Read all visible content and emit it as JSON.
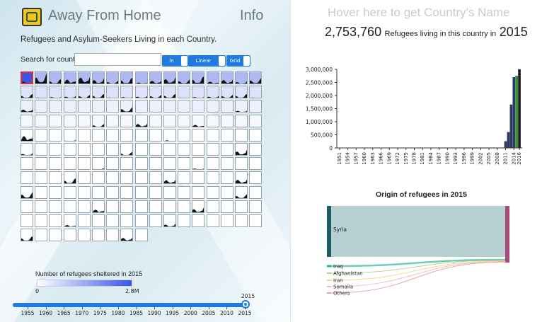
{
  "header": {
    "app_title": "Away From Home",
    "info_label": "Info",
    "subtitle": "Refugees and Asylum-Seekers Living in each Country."
  },
  "search": {
    "label": "Search for country:",
    "value": ""
  },
  "toggles": [
    {
      "label": "ln"
    },
    {
      "label": "Linear"
    },
    {
      "label": "Grid"
    }
  ],
  "legend": {
    "title": "Number of refugees sheltered in 2015",
    "min_label": "0",
    "max_label": "2.8M",
    "colors": [
      "#ffffff",
      "#3b55e6"
    ]
  },
  "slider": {
    "value": "2015",
    "ticks": [
      "1955",
      "1960",
      "1965",
      "1970",
      "1975",
      "1980",
      "1985",
      "1990",
      "1995",
      "2000",
      "2005",
      "2010",
      "2015"
    ]
  },
  "info_panel": {
    "hover_prompt": "Hover here to get Country's Name",
    "count": "2,753,760",
    "count_text": "Refugees living in this country in",
    "year": "2015"
  },
  "chart_data": [
    {
      "type": "bar",
      "ylim": [
        0,
        3000000
      ],
      "yticks": [
        "0",
        "500,000",
        "1,000,000",
        "1,500,000",
        "2,000,000",
        "2,500,000",
        "3,000,000"
      ],
      "xticks": [
        "1951",
        "1954",
        "1957",
        "1960",
        "1963",
        "1966",
        "1969",
        "1972",
        "1975",
        "1978",
        "1981",
        "1984",
        "1987",
        "1990",
        "1993",
        "1996",
        "1999",
        "2002",
        "2005",
        "2008",
        "2011",
        "2014",
        "2016"
      ],
      "series": [
        {
          "x": [
            1987,
            1988,
            1989,
            1990,
            1991,
            1992,
            1993,
            1994,
            1995,
            1996,
            1997,
            1998,
            1999,
            2000,
            2001,
            2002,
            2003,
            2004,
            2005,
            2006,
            2007,
            2008,
            2009,
            2010,
            2011,
            2012,
            2013,
            2014,
            2015,
            2016
          ],
          "values": [
            5000,
            5000,
            5000,
            8000,
            8000,
            8000,
            8000,
            8000,
            8000,
            5000,
            5000,
            5000,
            5000,
            5000,
            5000,
            5000,
            5000,
            5000,
            5000,
            5000,
            5000,
            5000,
            8000,
            10000,
            250000,
            600000,
            1650000,
            2700000,
            2753760,
            3000000
          ]
        }
      ],
      "colors": {
        "normal": "#2a3a66",
        "highlight": "#2ca02c",
        "accent": "#1a1a1a"
      }
    },
    {
      "type": "sankey",
      "title": "Origin of refugees in 2015",
      "sources": [
        {
          "name": "Syria",
          "value": 2500000,
          "color": "#1e5c63"
        },
        {
          "name": "Iraq",
          "value": 60000,
          "color": "#2fb897"
        },
        {
          "name": "Afghanistan",
          "value": 35000,
          "color": "#8cc86a"
        },
        {
          "name": "Iran",
          "value": 20000,
          "color": "#f0c460"
        },
        {
          "name": "Somalia",
          "value": 15000,
          "color": "#f0a0b8"
        },
        {
          "name": "Others",
          "value": 10000,
          "color": "#e08080"
        }
      ],
      "target_color": "#a64b78"
    }
  ]
}
